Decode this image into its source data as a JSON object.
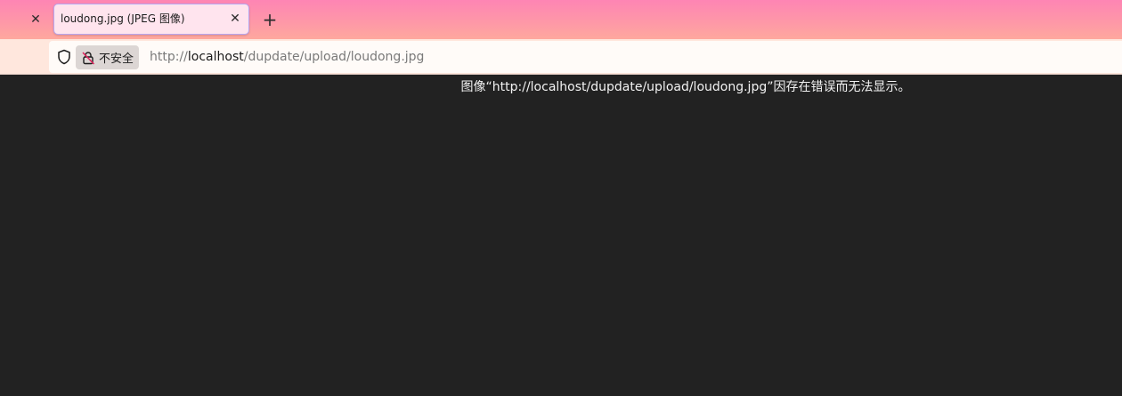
{
  "tabs": {
    "active_title": "loudong.jpg (JPEG 图像)",
    "close_glyph": "✕",
    "new_tab_glyph": "+"
  },
  "urlbar": {
    "insecure_label": "不安全",
    "url_prefix": "http://",
    "url_host": "localhost",
    "url_path": "/dupdate/upload/loudong.jpg"
  },
  "content": {
    "error_message": "图像“http://localhost/dupdate/upload/loudong.jpg”因存在错误而无法显示。"
  },
  "colors": {
    "tabstrip_top": "#fe85b4",
    "tabstrip_bottom": "#fea89e",
    "navbar": "#ffe7dd",
    "content_bg": "#222222",
    "active_tab_border": "#b7a6f0"
  }
}
